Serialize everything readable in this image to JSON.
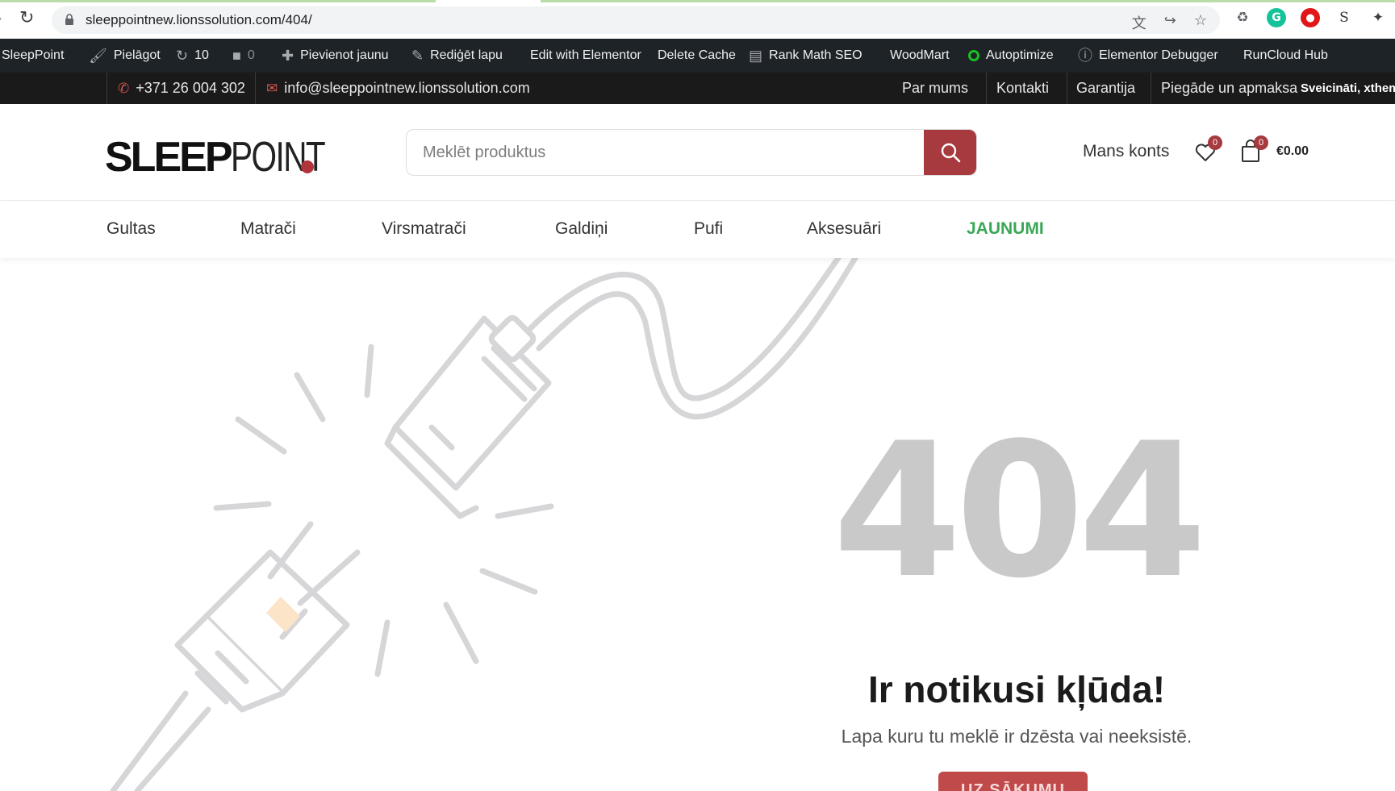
{
  "browser": {
    "url": "sleeppointnew.lionssolution.com/404/"
  },
  "adminbar": {
    "site": "SleepPoint",
    "customize": "Pielāgot",
    "updates": "10",
    "comments": "0",
    "new": "Pievienot jaunu",
    "edit_page": "Rediģēt lapu",
    "elementor": "Edit with Elementor",
    "delete_cache": "Delete Cache",
    "rank_math": "Rank Math SEO",
    "woodmart": "WoodMart",
    "autoptimize": "Autoptimize",
    "debugger": "Elementor Debugger",
    "runcloud": "RunCloud Hub"
  },
  "topbar": {
    "phone": "+371 26 004 302",
    "email": "info@sleeppointnew.lionssolution.com",
    "links": [
      "Par mums",
      "Kontakti",
      "Garantija",
      "Piegāde un apmaksa"
    ],
    "greeting": "Sveicināti, xthem"
  },
  "header": {
    "logo_bold": "SLEEP",
    "logo_thin": "POINT",
    "search_placeholder": "Meklēt produktus",
    "account": "Mans konts",
    "wishlist_count": "0",
    "cart_count": "0",
    "cart_total": "€0.00"
  },
  "nav": {
    "items": [
      "Gultas",
      "Matrači",
      "Virsmatrači",
      "Galdiņi",
      "Pufi",
      "Aksesuāri",
      "JAUNUMI"
    ]
  },
  "error": {
    "code": "404",
    "title": "Ir notikusi kļūda!",
    "subtitle": "Lapa kuru tu meklē ir dzēsta vai neeksistē.",
    "button": "UZ SĀKUMU"
  },
  "colors": {
    "brand_red": "#a63a3f",
    "accent_green": "#3aa856",
    "code_gray": "#c9c9c9"
  }
}
